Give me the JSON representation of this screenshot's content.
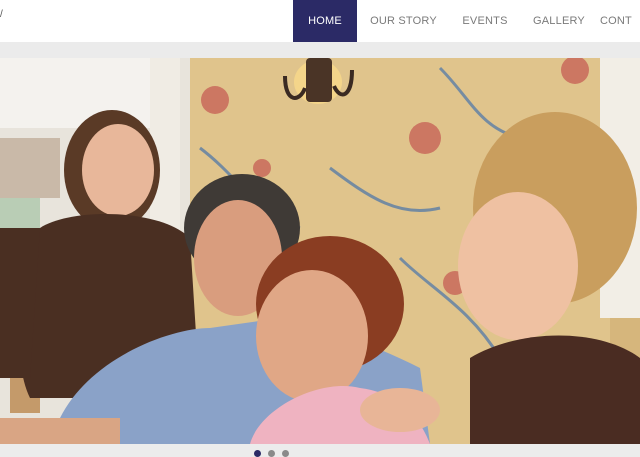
{
  "brand": {
    "fragment": "/"
  },
  "nav": {
    "items": [
      {
        "label": "HOME",
        "active": true
      },
      {
        "label": "OUR STORY",
        "active": false
      },
      {
        "label": "EVENTS",
        "active": false
      },
      {
        "label": "GALLERY",
        "active": false
      },
      {
        "label": "CONT",
        "active": false
      }
    ]
  },
  "slider": {
    "dots": [
      {
        "active": true
      },
      {
        "active": false
      },
      {
        "active": false
      }
    ]
  },
  "colors": {
    "nav_active": "#2b2a66",
    "nav_text": "#7a7a7a",
    "background": "#ececec"
  }
}
